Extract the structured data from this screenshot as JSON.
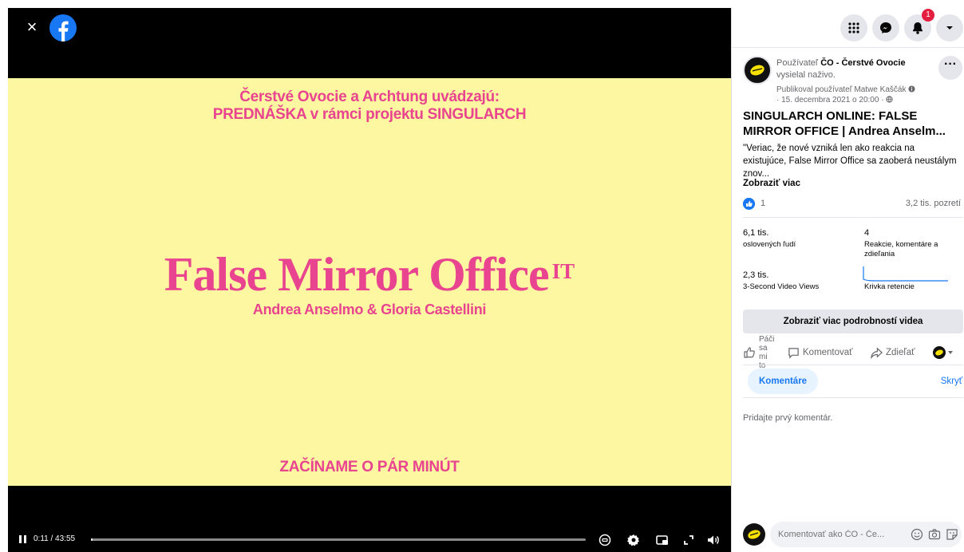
{
  "video": {
    "close_label": "×",
    "slide": {
      "intro_line1": "Čerstvé Ovocie a Archtung uvádzajú:",
      "intro_line2": "PREDNÁŠKA v rámci projektu SINGULARCH",
      "title": "False Mirror Office",
      "title_sup": "IT",
      "authors": "Andrea Anselmo & Gloria Castellini",
      "footer": "ZAČÍNAME O PÁR MINÚT"
    },
    "controls": {
      "time": "0:11 / 43:55",
      "progress": 0.004
    }
  },
  "topbar": {
    "notification_count": "1"
  },
  "post": {
    "author_prefix": "Používateľ",
    "author_name": "ČO - Čerstvé Ovocie",
    "author_action": "vysielal naživo.",
    "published_by": "Publikoval používateľ Matwe Kaščák",
    "date": "· 15. decembra 2021 o 20:00 ·",
    "more_label": "···",
    "title": "SINGULARCH ONLINE: FALSE MIRROR OFFICE | Andrea Anselm...",
    "description": "\"Veriac, že nové vzniká len ako reakcia na existujúce, False Mirror Office sa zaoberá neustálym znov...",
    "see_more": "Zobraziť viac",
    "like_count": "1",
    "views": "3,2 tis. pozretí"
  },
  "stats": {
    "reached_value": "6,1 tis.",
    "reached_label": "oslovených ľudí",
    "reactions_value": "4",
    "reactions_label": "Reakcie, komentáre a zdieľania",
    "views3s_value": "2,3 tis.",
    "views3s_label": "3-Second Video Views",
    "retention_label": "Krivka retencie"
  },
  "actions": {
    "details_button": "Zobraziť viac podrobností videa",
    "like": "Páči sa mi to",
    "comment": "Komentovať",
    "share": "Zdieľať"
  },
  "comments": {
    "tab": "Komentáre",
    "hide": "Skryť",
    "empty": "Pridajte prvý komentár.",
    "input_placeholder": "Komentovať ako ČO - Če..."
  }
}
